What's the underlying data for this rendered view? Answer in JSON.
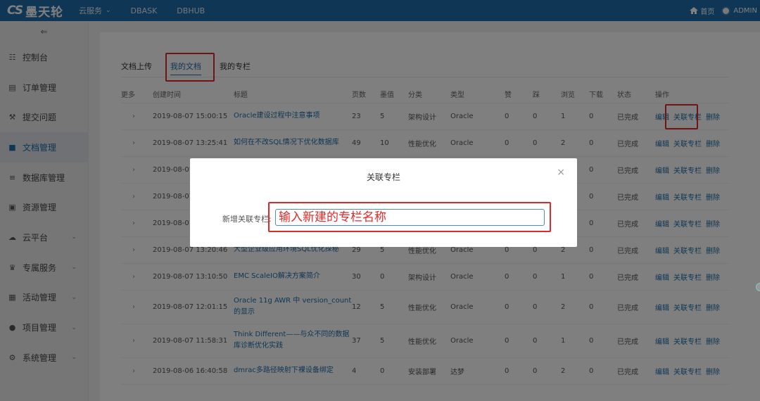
{
  "brand": {
    "mark": "CS",
    "name": "墨天轮"
  },
  "topnav": [
    {
      "label": "云服务",
      "has_dropdown": true
    },
    {
      "label": "DBASK",
      "has_dropdown": false
    },
    {
      "label": "DBHUB",
      "has_dropdown": false
    }
  ],
  "topright": {
    "home": "首页",
    "user": "ADMIN"
  },
  "sidebar": {
    "collapse_icon": "collapse-icon",
    "items": [
      {
        "label": "控制台",
        "icon": "dashboard-icon",
        "active": false,
        "has_chevron": false
      },
      {
        "label": "订单管理",
        "icon": "order-icon",
        "active": false,
        "has_chevron": false
      },
      {
        "label": "提交问题",
        "icon": "wrench-icon",
        "active": false,
        "has_chevron": false
      },
      {
        "label": "文档管理",
        "icon": "document-icon",
        "active": true,
        "has_chevron": false
      },
      {
        "label": "数据库管理",
        "icon": "database-icon",
        "active": false,
        "has_chevron": false
      },
      {
        "label": "资源管理",
        "icon": "resource-icon",
        "active": false,
        "has_chevron": false
      },
      {
        "label": "云平台",
        "icon": "cloud-icon",
        "active": false,
        "has_chevron": true
      },
      {
        "label": "专属服务",
        "icon": "crown-icon",
        "active": false,
        "has_chevron": true
      },
      {
        "label": "活动管理",
        "icon": "activity-icon",
        "active": false,
        "has_chevron": true
      },
      {
        "label": "项目管理",
        "icon": "bulb-icon",
        "active": false,
        "has_chevron": true
      },
      {
        "label": "系统管理",
        "icon": "gear-icon",
        "active": false,
        "has_chevron": true
      }
    ]
  },
  "tabs": [
    {
      "label": "文档上传",
      "active": false
    },
    {
      "label": "我的文档",
      "active": true
    },
    {
      "label": "我的专栏",
      "active": false
    }
  ],
  "table": {
    "columns": [
      "更多",
      "创建时间",
      "标题",
      "页数",
      "墨值",
      "分类",
      "类型",
      "赞",
      "踩",
      "浏览",
      "下载",
      "状态",
      "操作"
    ],
    "actions": [
      "编辑",
      "关联专栏",
      "删除"
    ],
    "rows": [
      {
        "time": "2019-08-07 15:00:15",
        "title": "Oracle建设过程中注意事项",
        "pages": "23",
        "value": "5",
        "category": "架构设计",
        "type": "Oracle",
        "likes": "0",
        "dislikes": "0",
        "views": "1",
        "downloads": "0",
        "status": "已完成"
      },
      {
        "time": "2019-08-07 13:25:41",
        "title": "如何在不改SQL情况下优化数据库",
        "pages": "49",
        "value": "10",
        "category": "性能优化",
        "type": "Oracle",
        "likes": "0",
        "dislikes": "0",
        "views": "2",
        "downloads": "0",
        "status": "已完成"
      },
      {
        "time": "2019-08-07",
        "title": "",
        "pages": "",
        "value": "",
        "category": "",
        "type": "",
        "likes": "",
        "dislikes": "",
        "views": "",
        "downloads": "0",
        "status": "已完成"
      },
      {
        "time": "2019-08-07",
        "title": "",
        "pages": "",
        "value": "",
        "category": "",
        "type": "",
        "likes": "",
        "dislikes": "",
        "views": "",
        "downloads": "0",
        "status": "已完成"
      },
      {
        "time": "2019-08-07",
        "title": "",
        "pages": "",
        "value": "",
        "category": "",
        "type": "",
        "likes": "",
        "dislikes": "",
        "views": "",
        "downloads": "0",
        "status": "已完成"
      },
      {
        "time": "2019-08-07 13:20:46",
        "title": "大型企业级应用环境SQL优化探秘",
        "pages": "29",
        "value": "5",
        "category": "性能优化",
        "type": "Oracle",
        "likes": "0",
        "dislikes": "0",
        "views": "2",
        "downloads": "0",
        "status": "已完成"
      },
      {
        "time": "2019-08-07 13:10:50",
        "title": "EMC ScaleIO解决方案简介",
        "pages": "30",
        "value": "0",
        "category": "架构设计",
        "type": "Oracle",
        "likes": "0",
        "dislikes": "0",
        "views": "1",
        "downloads": "0",
        "status": "已完成"
      },
      {
        "time": "2019-08-07 12:01:15",
        "title": "Oracle 11g AWR 中 version_count 的显示",
        "pages": "12",
        "value": "5",
        "category": "性能优化",
        "type": "Oracle",
        "likes": "0",
        "dislikes": "0",
        "views": "2",
        "downloads": "0",
        "status": "已完成"
      },
      {
        "time": "2019-08-07 11:58:31",
        "title": "Think Different——与众不同的数据库诊断优化实践",
        "pages": "37",
        "value": "5",
        "category": "性能优化",
        "type": "Oracle",
        "likes": "0",
        "dislikes": "0",
        "views": "1",
        "downloads": "0",
        "status": "已完成"
      },
      {
        "time": "2019-08-06 16:40:58",
        "title": "dmrac多路径映射下裸设备绑定",
        "pages": "4",
        "value": "0",
        "category": "安装部署",
        "type": "达梦",
        "likes": "0",
        "dislikes": "0",
        "views": "2",
        "downloads": "0",
        "status": "已完成"
      }
    ]
  },
  "modal": {
    "title": "关联专栏",
    "close": "×",
    "label": "新增关联专栏:",
    "input_placeholder": "输入新建的专栏名称"
  },
  "colors": {
    "topbar": "#1e6ca8",
    "accent": "#1e6ca8",
    "highlight": "#e02a2a"
  }
}
